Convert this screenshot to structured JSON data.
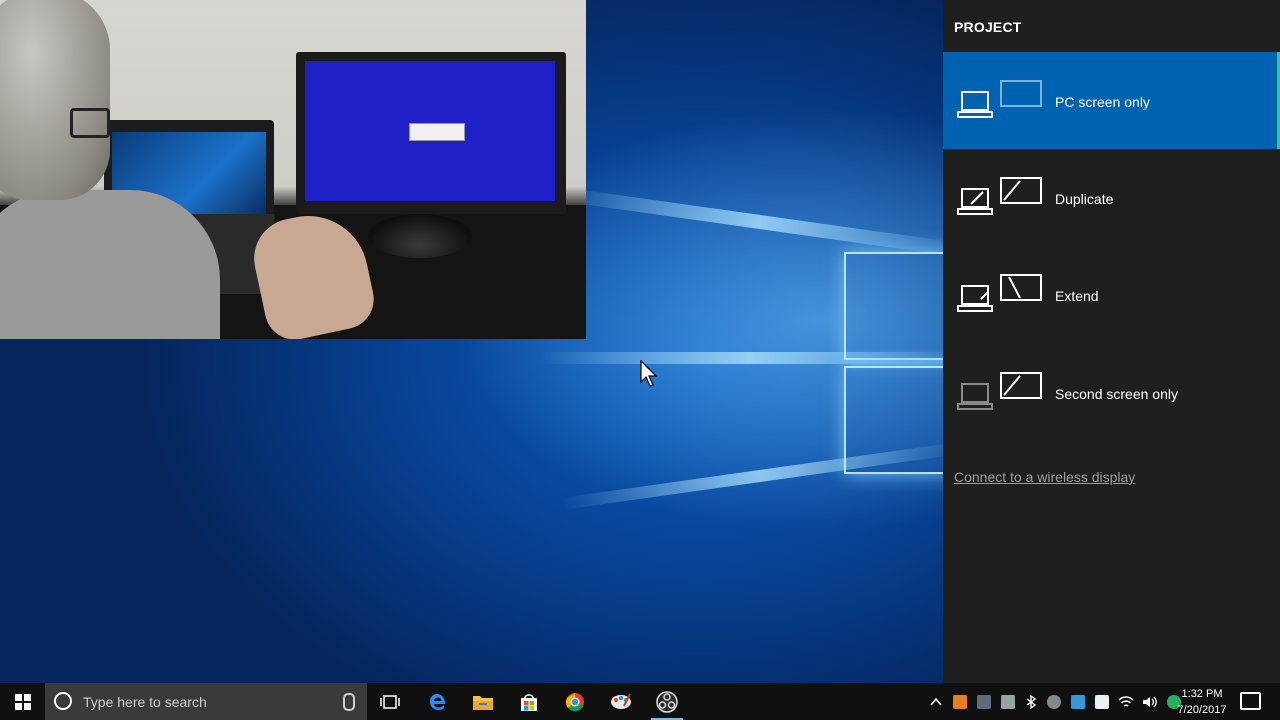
{
  "panel": {
    "title": "PROJECT",
    "options": [
      {
        "label": "PC screen only",
        "icon": "pc-screen-only-icon",
        "selected": true
      },
      {
        "label": "Duplicate",
        "icon": "duplicate-icon",
        "selected": false
      },
      {
        "label": "Extend",
        "icon": "extend-icon",
        "selected": false
      },
      {
        "label": "Second screen only",
        "icon": "second-screen-only-icon",
        "selected": false
      }
    ],
    "wireless_link": "Connect to a wireless display"
  },
  "taskbar": {
    "search_placeholder": "Type here to search",
    "pinned": [
      "task-view-icon",
      "edge-icon",
      "file-explorer-icon",
      "store-icon",
      "chrome-icon",
      "paint-icon",
      "obs-icon"
    ],
    "clock_time": "1:32 PM",
    "clock_date": "7/20/2017"
  },
  "colors": {
    "selected_option": "#0063b1",
    "panel_bg": "#1f1f1f",
    "taskbar_bg": "#101010",
    "accent_green": "#2ecc71"
  }
}
